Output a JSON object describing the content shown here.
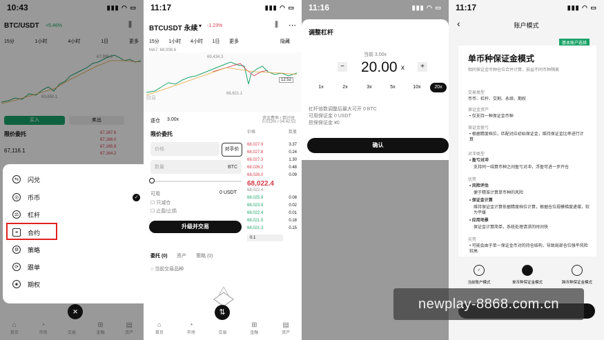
{
  "panel1": {
    "time": "10:43",
    "pair": "BTC/USDT",
    "change": "+5.46%",
    "timeframes": [
      "15分",
      "1小时",
      "4小时",
      "1日",
      "更多"
    ],
    "price_label_high": "67,995.6",
    "price_label_low": "63,650.1",
    "buy_label": "买入",
    "sell_label": "卖出",
    "order_type": "限价委托",
    "price_input": "67,116.1",
    "ob_prices": [
      "67,167.6",
      "67,166.0",
      "67,165.8",
      "67,164.2"
    ],
    "menu": [
      "闪兑",
      "币币",
      "杠杆",
      "合约",
      "策略",
      "跟单",
      "期权"
    ],
    "selected_menu": "币币",
    "highlighted_menu": "合约",
    "tabs": [
      "首页",
      "市场",
      "交易",
      "金融",
      "资产"
    ],
    "close_glyph": "×",
    "check_glyph": "✓"
  },
  "panel2": {
    "time": "11:17",
    "pair": "BTCUSDT 永续",
    "change": "-1.23%",
    "timeframes": [
      "15分",
      "1小时",
      "4小时",
      "1日",
      "更多"
    ],
    "hide_label": "隐藏",
    "ma_label": "MA7: 68,008.6",
    "chart_high": "69,434.3",
    "chart_low": "66,621.1",
    "price_tag": "12:52",
    "watermark": "欧易",
    "mode_label": "逐仓",
    "leverage": "3.00x",
    "funding_label": "资金费率 / 倒计时",
    "funding_value": "0.013% / 04:42:52",
    "order_type": "限价委托",
    "counter_price_btn": "对手价",
    "price_placeholder": "价格",
    "amount_placeholder": "数量",
    "unit": "BTC",
    "available_label": "可用",
    "available_value": "0 USDT",
    "reduce_only": "只减仓",
    "take_profit": "止盈/止损",
    "upgrade_btn": "升级并交易",
    "ob_header_price": "价格",
    "ob_header_amount": "数量",
    "asks": [
      [
        "68,027.9",
        "3.37"
      ],
      [
        "68,027.8",
        "0.24"
      ],
      [
        "68,027.3",
        "1.30"
      ],
      [
        "68,026.2",
        "0.48"
      ],
      [
        "68,026.0",
        "0.09"
      ]
    ],
    "last_price": "68,022.4",
    "last_price_sub": "68,022.4",
    "bids": [
      [
        "68,025.9",
        "0.08"
      ],
      [
        "68,023.9",
        "0.02"
      ],
      [
        "68,022.4",
        "0.01"
      ],
      [
        "68,021.5",
        "0.18"
      ],
      [
        "68,021.3",
        "0.15"
      ]
    ],
    "depth_value": "0.1",
    "orders_tab": "委托 (0)",
    "assets_tab": "资产",
    "strategy_tab": "策略 (0)",
    "current_pair_only": "当前交易品种",
    "tabs": [
      "首页",
      "市场",
      "交易",
      "金融",
      "资产"
    ]
  },
  "panel3": {
    "time": "11:16",
    "title": "调整杠杆",
    "current_label": "当前 3.00x",
    "leverage_value": "20.00",
    "unit": "x",
    "minus": "−",
    "plus": "+",
    "presets": [
      "1x",
      "2x",
      "3x",
      "5x",
      "10x",
      "20x"
    ],
    "selected_preset": "20x",
    "info1": "杠杆倍数调整后最大可开 0 BTC",
    "info2": "可用保证金 0 USDT",
    "info3": "担保保证金 ¥0",
    "confirm_btn": "确认"
  },
  "panel4": {
    "time": "11:17",
    "title": "账户模式",
    "back": "‹",
    "tag": "基本账户选择",
    "heading": "单币种保证金模式",
    "subtitle": "相同保证金币种仓位合并计算，损益不同币种隔离",
    "s1_title": "交易类型",
    "s1_text": "币币、杠杆、交割、永续、期权",
    "s2_title": "保证金资产",
    "s2_text": "仅支持一种保证金币种",
    "s3_title": "保证金盈亏",
    "s3_text": "根据精度档位，匹配对应初始保证金，维持保证金比率进行计算",
    "s4_title": "对冲类型",
    "s4_b": "盈亏对冲",
    "s4_text": "支持同一结算币种之间盈亏对冲，浮盈可进一步开仓",
    "s5_title": "优势",
    "s5_b1": "风险评估",
    "s5_t1": "便于精准计算单币种的风险",
    "s5_b2": "保证金计算",
    "s5_t2": "维持保证金计算依据精度档位计算，根据仓位规模梯度递增，较为平缓",
    "s5_b3": "应用场景",
    "s5_t3": "保证金计算简单，系统处理请求的时间快",
    "s6_title": "劣势",
    "s6_text": "可能会由于单一保证金币对的持仓结构，导致局部仓位强平风险较高",
    "options": [
      "当前账户模式",
      "单币种保证金模式",
      "跨币种保证金模式"
    ]
  },
  "watermark": "newplay-8868.com.cn"
}
